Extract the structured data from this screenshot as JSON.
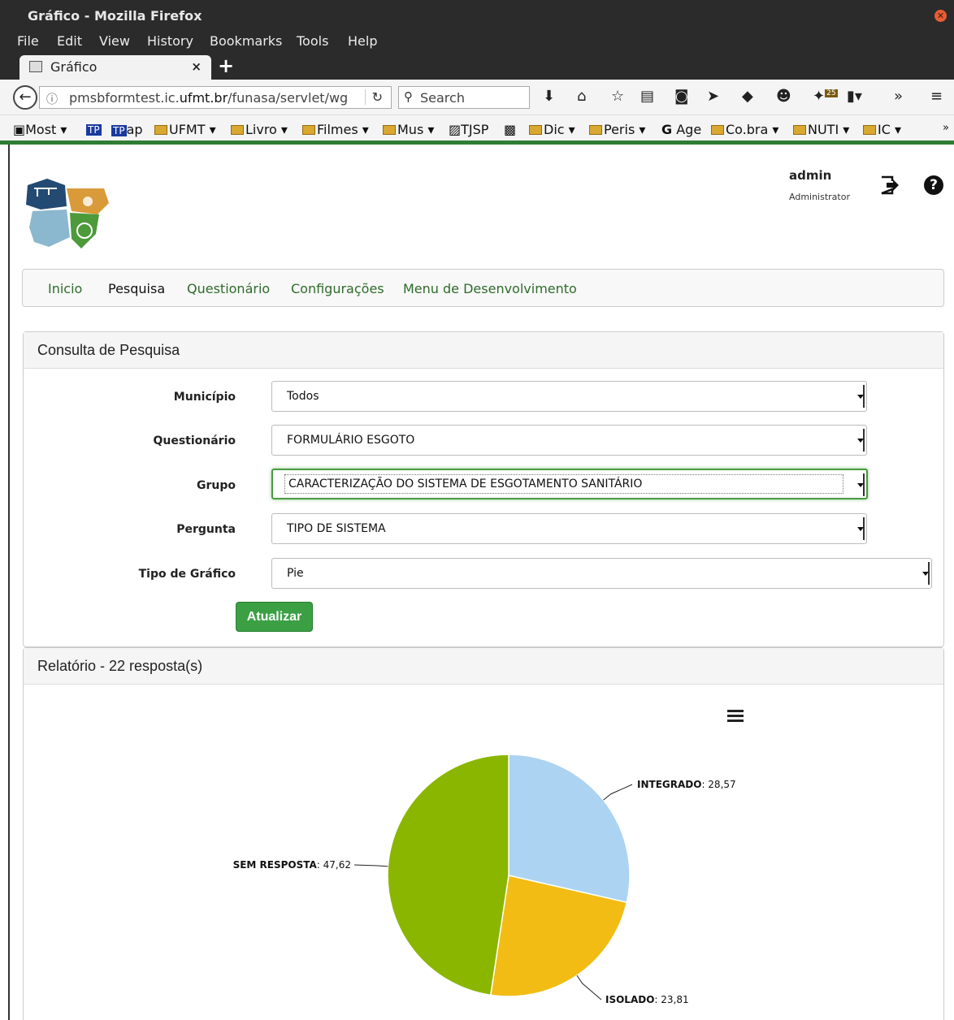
{
  "window": {
    "title": "Gráfico - Mozilla Firefox"
  },
  "menu": {
    "items": [
      "File",
      "Edit",
      "View",
      "History",
      "Bookmarks",
      "Tools",
      "Help"
    ]
  },
  "tab": {
    "label": "Gráfico"
  },
  "urlbar": {
    "host_prefix": "pmsbformtest.ic.",
    "host_domain": "ufmt.br",
    "path": "/funasa/servlet/wg"
  },
  "search": {
    "placeholder": "Search"
  },
  "toolbar": {
    "badge": "25"
  },
  "bookmarks": [
    "Most",
    "ap",
    "UFMT",
    "Livro",
    "Filmes",
    "Mus",
    "TJSP",
    "Dic",
    "Peris",
    "Age",
    "Co.bra",
    "NUTI",
    "IC"
  ],
  "user": {
    "name": "admin",
    "role": "Administrator"
  },
  "nav": [
    "Inicio",
    "Pesquisa",
    "Questionário",
    "Configurações",
    "Menu de Desenvolvimento"
  ],
  "form": {
    "title": "Consulta de Pesquisa",
    "municipio": {
      "label": "Município",
      "value": "Todos"
    },
    "questionario": {
      "label": "Questionário",
      "value": "FORMULÁRIO ESGOTO"
    },
    "grupo": {
      "label": "Grupo",
      "value": "CARACTERIZAÇÃO DO SISTEMA DE ESGOTAMENTO SANITÁRIO"
    },
    "pergunta": {
      "label": "Pergunta",
      "value": "TIPO DE SISTEMA"
    },
    "tipo": {
      "label": "Tipo de Gráfico",
      "value": "Pie"
    },
    "submit": "Atualizar"
  },
  "report": {
    "title": "Relatório - 22 resposta(s)"
  },
  "chart_data": {
    "type": "pie",
    "slices": [
      {
        "label": "INTEGRADO",
        "value": 28.57,
        "display": "28,57",
        "color": "#acd3f2"
      },
      {
        "label": "ISOLADO",
        "value": 23.81,
        "display": "23,81",
        "color": "#f2bc14"
      },
      {
        "label": "SEM RESPOSTA",
        "value": 47.62,
        "display": "47,62",
        "color": "#8ab600"
      }
    ]
  }
}
